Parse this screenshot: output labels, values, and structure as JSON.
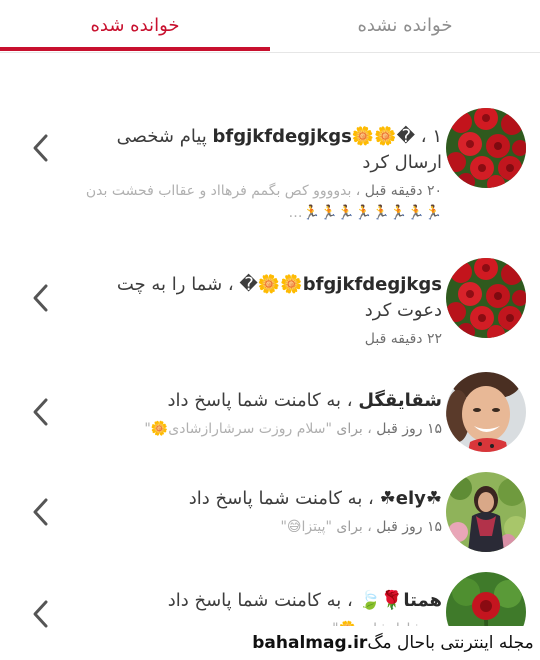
{
  "tabs": {
    "read": "خوانده شده",
    "unread": "خوانده نشده"
  },
  "notifications": [
    {
      "username": "bfgjkfdegjkgs",
      "user_suffix": "🌼🌼�",
      "action": " ، ۱ پیام شخصی ارسال کرد",
      "time": "۲۰ دقیقه قبل",
      "separator": " ، ",
      "preview": "بدوووو کص   بگمم فرهااد و عقااب فحشت بدن🏃🏃🏃🏃🏃🏃🏃🏃…",
      "avatar": "red-roses-avatar"
    },
    {
      "username": "bfgjkfdegjkgs",
      "user_suffix": "🌼🌼�",
      "action": " ، شما را به چت دعوت کرد",
      "time": "۲۲ دقیقه قبل",
      "avatar": "red-roses-avatar"
    },
    {
      "username": "شقایقگل",
      "action": " ، به کامنت شما پاسخ داد",
      "time": "۱۵ روز قبل",
      "separator": " ، ",
      "for_label": "برای",
      "quote": " \"سلام روزت سرشارازشادی🌼\"",
      "avatar": "smiling-woman-avatar"
    },
    {
      "username": "☘ely☘",
      "action": " ، به کامنت شما پاسخ داد",
      "time": "۱۵ روز قبل",
      "separator": " ، ",
      "for_label": "برای",
      "quote": " \"پیتزا😅\"",
      "avatar": "woman-garden-avatar"
    },
    {
      "username": "همتا",
      "user_suffix": "🌹🍃",
      "action": " ، به کامنت شما پاسخ داد",
      "quote": "سرشارازشادی🌼\"",
      "avatar": "rose-avatar"
    }
  ],
  "watermark": {
    "site": "bahalmag.ir",
    "text": "مجله اینترنتی باحال مگ"
  }
}
